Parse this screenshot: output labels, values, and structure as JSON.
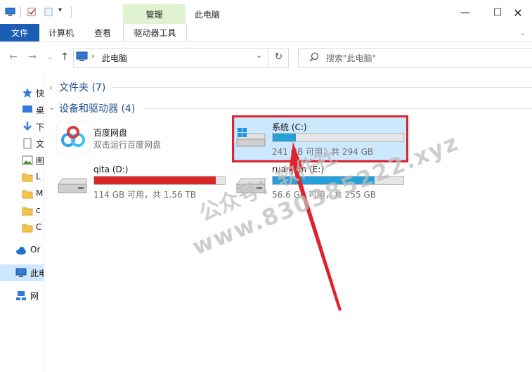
{
  "window": {
    "title": "此电脑",
    "context_tab": "管理",
    "controls": [
      "minimize",
      "maximize",
      "close"
    ]
  },
  "ribbon": {
    "tabs": [
      {
        "label": "文件"
      },
      {
        "label": "计算机"
      },
      {
        "label": "查看"
      },
      {
        "label": "驱动器工具"
      }
    ]
  },
  "address": {
    "breadcrumb": "此电脑",
    "search_placeholder": "搜索\"此电脑\""
  },
  "sidebar": {
    "items": [
      {
        "label": "快",
        "icon": "star-icon"
      },
      {
        "label": "桌",
        "icon": "desktop-icon"
      },
      {
        "label": "下",
        "icon": "download-icon"
      },
      {
        "label": "文",
        "icon": "document-icon"
      },
      {
        "label": "图",
        "icon": "picture-icon"
      },
      {
        "label": "L",
        "icon": "folder-icon"
      },
      {
        "label": "M",
        "icon": "folder-icon"
      },
      {
        "label": "c",
        "icon": "folder-icon"
      },
      {
        "label": "C",
        "icon": "folder-icon"
      },
      {
        "label": "Or",
        "icon": "cloud-icon"
      },
      {
        "label": "此电",
        "icon": "pc-icon"
      },
      {
        "label": "网",
        "icon": "network-icon"
      }
    ]
  },
  "content": {
    "folders_section": "文件夹 (7)",
    "devices_section": "设备和驱动器 (4)",
    "drives": [
      {
        "name": "百度网盘",
        "sub": "双击运行百度网盘",
        "kind": "app"
      },
      {
        "name": "系统 (C:)",
        "sub": "241 GB 可用，共 294 GB",
        "used_fraction": 0.18,
        "bar_color": "#26a0da",
        "kind": "system"
      },
      {
        "name": "qita (D:)",
        "sub": "114 GB 可用，共 1.56 TB",
        "used_fraction": 0.93,
        "bar_color": "#da2626",
        "kind": "hdd"
      },
      {
        "name": "ruanjian (E:)",
        "sub": "56.6 GB 可用，共 255 GB",
        "used_fraction": 0.78,
        "bar_color": "#26a0da",
        "kind": "hdd"
      }
    ]
  },
  "watermark": {
    "line1": "公众号：软件社",
    "line2": "www.830385222.xyz"
  }
}
